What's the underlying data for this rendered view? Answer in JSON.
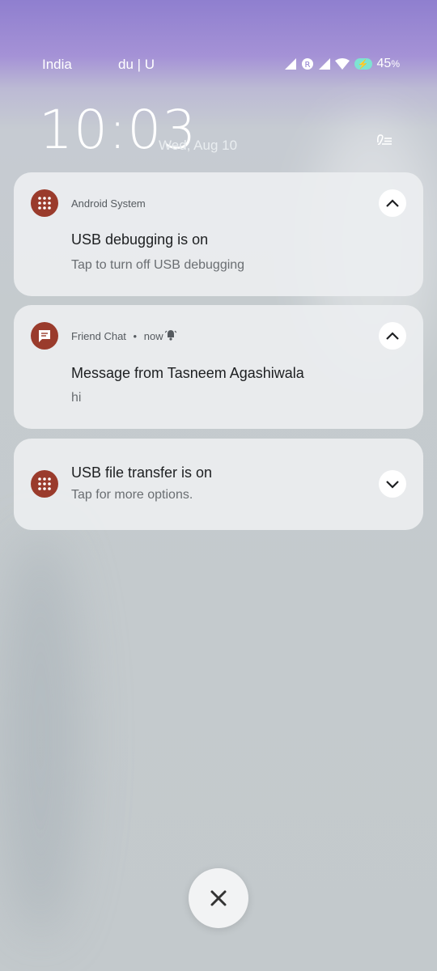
{
  "status_bar": {
    "carrier_1": "India",
    "carrier_2": "du | U",
    "battery_percent": "45",
    "battery_unit": "%"
  },
  "lock_screen": {
    "time": "10:03",
    "date": "Wed, Aug 10"
  },
  "notifications": [
    {
      "app": "Android System",
      "title": "USB debugging is on",
      "text": "Tap to turn off USB debugging",
      "icon": "grid-dots-icon",
      "expanded": true
    },
    {
      "app": "Friend Chat",
      "meta": "now",
      "title": "Message from Tasneem Agashiwala",
      "text": "hi",
      "icon": "chat-bubble-icon",
      "expanded": true
    },
    {
      "title": "USB file transfer is on",
      "text": "Tap for more options.",
      "icon": "grid-dots-icon",
      "expanded": false
    }
  ],
  "colors": {
    "app_icon_bg": "#9a3b2c",
    "card_bg": "#eceef0"
  }
}
